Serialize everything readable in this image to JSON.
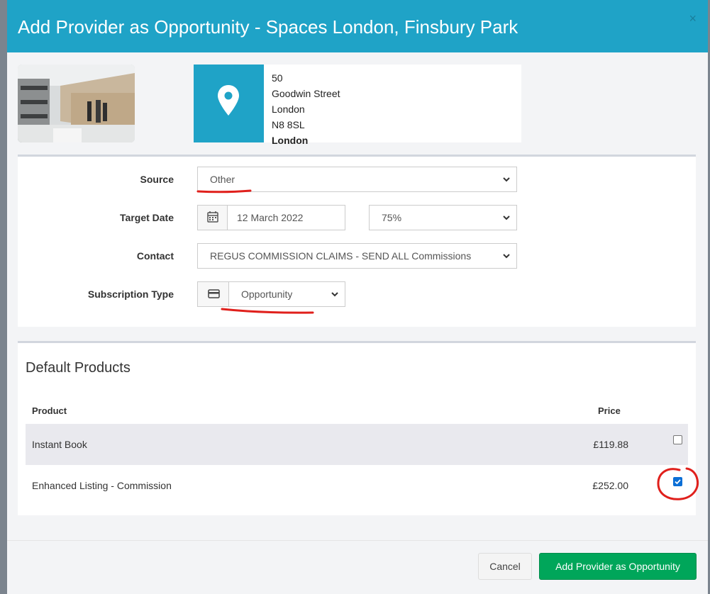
{
  "modal": {
    "title": "Add Provider as Opportunity - Spaces London, Finsbury Park",
    "close_label": "×"
  },
  "address": {
    "line1": "50",
    "line2": "Goodwin Street",
    "line3": "London",
    "line4": "N8 8SL",
    "city": "London"
  },
  "form": {
    "source_label": "Source",
    "source_value": "Other",
    "target_date_label": "Target Date",
    "target_date_value": "12 March 2022",
    "probability_value": "75%",
    "contact_label": "Contact",
    "contact_value": "REGUS COMMISSION CLAIMS - SEND ALL Commissions",
    "subscription_label": "Subscription Type",
    "subscription_value": "Opportunity"
  },
  "products": {
    "title": "Default Products",
    "col_product": "Product",
    "col_price": "Price",
    "rows": [
      {
        "name": "Instant Book",
        "price": "£119.88",
        "checked": false
      },
      {
        "name": "Enhanced Listing - Commission",
        "price": "£252.00",
        "checked": true
      }
    ]
  },
  "buttons": {
    "cancel": "Cancel",
    "submit": "Add Provider as Opportunity"
  },
  "colors": {
    "header": "#1fa3c7",
    "primary_button": "#00a65a",
    "annotation": "#e0201c"
  },
  "icons": [
    "close-icon",
    "map-pin-icon",
    "calendar-icon",
    "credit-card-icon",
    "chevron-down-icon"
  ]
}
